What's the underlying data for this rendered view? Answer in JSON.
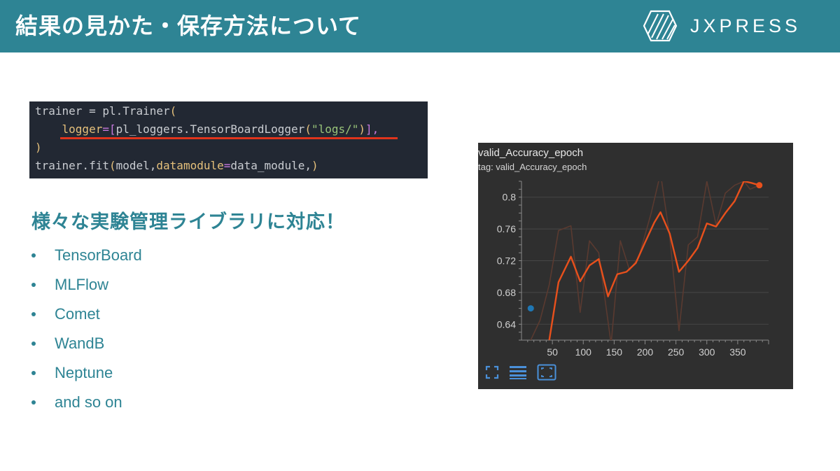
{
  "header": {
    "title": "結果の見かた・保存方法について",
    "logo_text": "JXPRESS",
    "background": "#2e8494"
  },
  "code": {
    "lines": [
      [
        {
          "t": "trainer = pl.Trainer",
          "c": "ident"
        },
        {
          "t": "(",
          "c": "paren"
        }
      ],
      [
        {
          "t": "    logger",
          "c": "kw"
        },
        {
          "t": "=[",
          "c": "punc"
        },
        {
          "t": "pl_loggers.TensorBoardLogger",
          "c": "ident"
        },
        {
          "t": "(",
          "c": "paren"
        },
        {
          "t": "\"logs/\"",
          "c": "str"
        },
        {
          "t": ")",
          "c": "paren"
        },
        {
          "t": "],",
          "c": "punc"
        }
      ],
      [
        {
          "t": ")",
          "c": "paren"
        }
      ],
      [
        {
          "t": "trainer.fit",
          "c": "ident"
        },
        {
          "t": "(",
          "c": "paren"
        },
        {
          "t": "model,",
          "c": "ident"
        },
        {
          "t": "datamodule",
          "c": "kw"
        },
        {
          "t": "=",
          "c": "punc"
        },
        {
          "t": "data_module,",
          "c": "ident"
        },
        {
          "t": ")",
          "c": "paren"
        }
      ]
    ]
  },
  "heading": "様々な実験管理ライブラリに対応！",
  "bullets": [
    "TensorBoard",
    "MLFlow",
    "Comet",
    "WandB",
    "Neptune",
    "and so on"
  ],
  "panel": {
    "title": "valid_Accuracy_epoch",
    "tag": "tag: valid_Accuracy_epoch",
    "toolbar_icons": [
      "fullscreen-icon",
      "list-icon",
      "fit-domain-icon"
    ]
  },
  "chart_data": {
    "type": "line",
    "title": "valid_Accuracy_epoch",
    "xlabel": "",
    "ylabel": "",
    "xlim": [
      0,
      400
    ],
    "ylim": [
      0.62,
      0.82
    ],
    "x_ticks": [
      50,
      100,
      150,
      200,
      250,
      300,
      350
    ],
    "y_ticks": [
      0.64,
      0.68,
      0.72,
      0.76,
      0.8
    ],
    "series": [
      {
        "role": "raw",
        "color": "#5a3a30",
        "x": [
          15,
          30,
          45,
          60,
          80,
          95,
          110,
          125,
          145,
          160,
          175,
          190,
          210,
          225,
          240,
          255,
          270,
          285,
          300,
          315,
          330,
          345,
          360,
          370,
          385
        ],
        "y": [
          0.62,
          0.645,
          0.69,
          0.758,
          0.764,
          0.655,
          0.745,
          0.73,
          0.615,
          0.745,
          0.708,
          0.725,
          0.78,
          0.83,
          0.75,
          0.632,
          0.74,
          0.75,
          0.82,
          0.765,
          0.805,
          0.815,
          0.82,
          0.81,
          0.815
        ]
      },
      {
        "role": "smoothed",
        "color": "#e8501c",
        "x": [
          45,
          60,
          80,
          95,
          110,
          125,
          140,
          155,
          170,
          185,
          200,
          215,
          225,
          240,
          255,
          270,
          285,
          300,
          315,
          330,
          345,
          360,
          372,
          385
        ],
        "y": [
          0.62,
          0.693,
          0.725,
          0.694,
          0.714,
          0.722,
          0.675,
          0.703,
          0.706,
          0.717,
          0.743,
          0.768,
          0.781,
          0.754,
          0.706,
          0.72,
          0.736,
          0.767,
          0.763,
          0.78,
          0.795,
          0.82,
          0.818,
          0.815
        ]
      }
    ],
    "markers": [
      {
        "x": 385,
        "y": 0.815,
        "color": "#e8501c"
      },
      {
        "x": 15,
        "y": 0.66,
        "color": "#1f77b4"
      }
    ],
    "grid": true
  }
}
